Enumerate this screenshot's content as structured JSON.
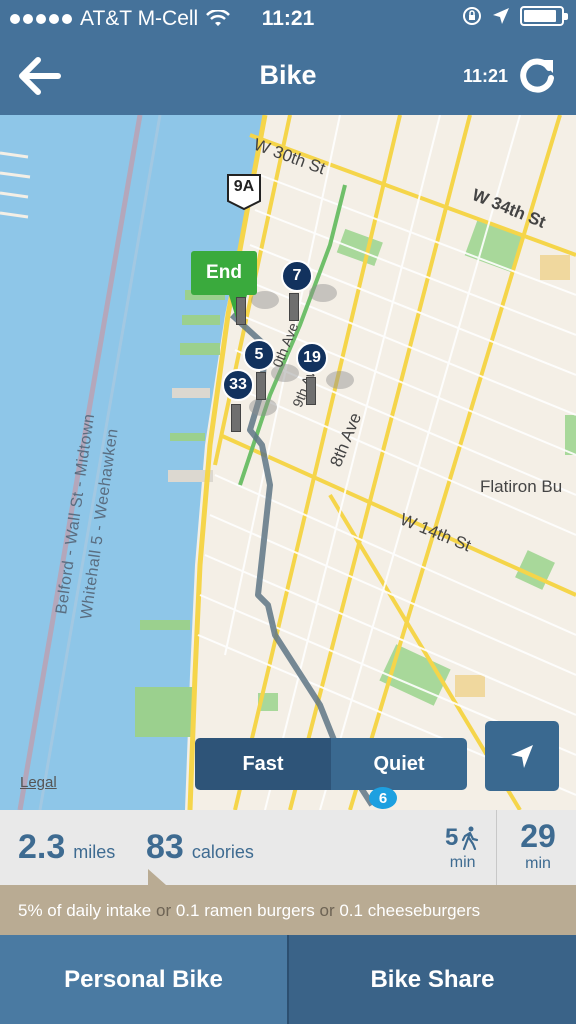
{
  "status_bar": {
    "carrier": "AT&T M-Cell",
    "time": "11:21",
    "battery_level": 0.9
  },
  "nav": {
    "title": "Bike",
    "time": "11:21",
    "back_icon": "back-arrow-icon",
    "refresh_icon": "refresh-icon"
  },
  "map": {
    "streets": {
      "w30": "W 30th St",
      "w34": "W 34th St",
      "w14": "W 14th St",
      "ave8": "8th Ave",
      "ave9": "9th Ave",
      "ave10": "0th Ave",
      "flatiron": "Flatiron Bu"
    },
    "highway_shield": "9A",
    "ferry_1": "Belford - Wall St - Midtown",
    "ferry_2": "Whitehall 5 - Weehawken",
    "legal": "Legal",
    "end_label": "End",
    "stations": [
      "7",
      "5",
      "19",
      "33"
    ],
    "route_badge": "6"
  },
  "route_toggle": {
    "fast": "Fast",
    "quiet": "Quiet",
    "selected": "Fast"
  },
  "stats": {
    "distance_value": "2.3",
    "distance_unit": "miles",
    "calories_value": "83",
    "calories_unit": "calories",
    "walk_value": "5",
    "walk_unit": "min",
    "bike_value": "29",
    "bike_unit": "min"
  },
  "intake": {
    "part1": "5% of daily intake",
    "or1": "or",
    "part2": "0.1 ramen burgers",
    "or2": "or",
    "part3": "0.1 cheeseburgers"
  },
  "tabs": {
    "personal": "Personal Bike",
    "share": "Bike Share"
  },
  "colors": {
    "nav_blue": "#45729a",
    "end_green": "#3aaa3d",
    "station_navy": "#12325e",
    "water": "#8ec6e8"
  }
}
